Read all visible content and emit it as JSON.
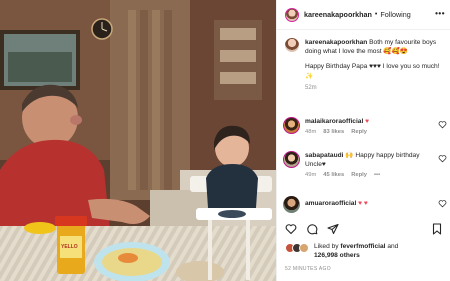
{
  "post": {
    "author": "kareenakapoorkhan",
    "follow_status": "Following",
    "separator": "•",
    "more": "•••"
  },
  "caption": {
    "username": "kareenakapoorkhan",
    "line1": "Both my favourite boys doing what I love the most 🥰🥰😍",
    "line2": "Happy Birthday Papa ♥♥♥ I love you so much! ✨",
    "time": "52m"
  },
  "comments": [
    {
      "username": "malaikaroraofficial",
      "text": "♥",
      "time": "48m",
      "likes": "83 likes",
      "reply": "Reply"
    },
    {
      "username": "sabapataudi",
      "text": "🙌 Happy happy birthday Uncle♥",
      "time": "49m",
      "likes": "45 likes",
      "reply": "Reply",
      "more": "•••"
    },
    {
      "username": "amuaroraofficial",
      "text": "♥ ♥"
    }
  ],
  "likes": {
    "prefix": "Liked by",
    "user": "feverfmofficial",
    "middle": "and",
    "count": "126,998 others"
  },
  "timestamp": "52 MINUTES AGO",
  "photo": {
    "jar_label": "YELLO",
    "colors": {
      "shirt": "#b7322e",
      "baby_shirt": "#23313f",
      "wall": "#6b4a35"
    }
  }
}
